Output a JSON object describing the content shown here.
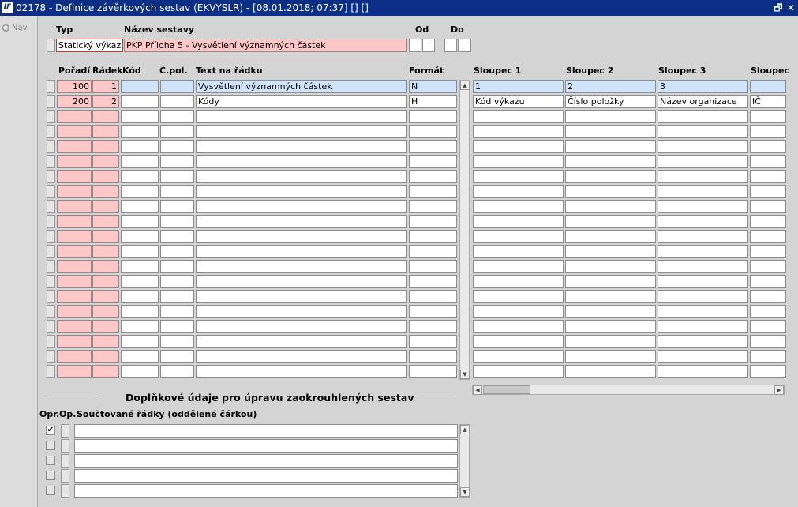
{
  "window": {
    "title": "02178 - Definice závěrkových sestav (EKVYSLR) - [08.01.2018; 07:37] [] []",
    "logo": "IF",
    "restore_glyph": "🗗",
    "close_glyph": "✕"
  },
  "nav": {
    "label": "Nav"
  },
  "header": {
    "typ_label": "Typ",
    "nazev_label": "Název sestavy",
    "od_label": "Od",
    "do_label": "Do",
    "typ_value": "Statický výkaz",
    "nazev_value": "PKP Příloha 5 - Vysvětlení významných částek"
  },
  "grid": {
    "columns": {
      "poradi": "Pořadí",
      "radek": "Řádek",
      "kod": "Kód",
      "cpol": "Č.pol.",
      "text": "Text na řádku",
      "format": "Formát",
      "s1": "Sloupec 1",
      "s2": "Sloupec 2",
      "s3": "Sloupec 3",
      "s4": "Sloupec"
    },
    "rows": [
      {
        "poradi": "100",
        "radek": "1",
        "kod": "",
        "cpol": "",
        "text": "Vysvětlení významných částek",
        "format": "N",
        "s1": "1",
        "s2": "2",
        "s3": "3",
        "s4": ""
      },
      {
        "poradi": "200",
        "radek": "2",
        "kod": "",
        "cpol": "",
        "text": "Kódy",
        "format": "H",
        "s1": "Kód výkazu",
        "s2": "Číslo položky",
        "s3": "Název organizace",
        "s4": "IČ"
      }
    ],
    "empty_row_count": 18
  },
  "supplement": {
    "title": "Doplňkové údaje pro úpravu zaokrouhlených sestav",
    "opr_label": "Opr.",
    "op_label": "Op.",
    "soucet_label": "Součtované řádky (oddělené čárkou)",
    "rows": [
      {
        "checked": true,
        "check_glyph": "✔",
        "value": ""
      },
      {
        "checked": false,
        "check_glyph": "",
        "value": ""
      },
      {
        "checked": false,
        "check_glyph": "",
        "value": ""
      },
      {
        "checked": false,
        "check_glyph": "",
        "value": ""
      },
      {
        "checked": false,
        "check_glyph": "",
        "value": ""
      }
    ]
  },
  "scroll": {
    "up_glyph": "▲",
    "down_glyph": "▼",
    "left_glyph": "◀",
    "right_glyph": "▶"
  }
}
